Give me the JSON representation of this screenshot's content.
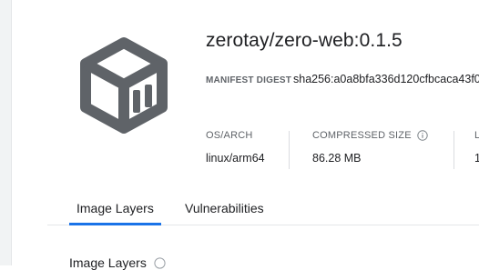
{
  "header": {
    "title": "zerotay/zero-web:0.1.5",
    "manifest_digest_label": "MANIFEST DIGEST",
    "manifest_digest_value": "sha256:a0a8bfa336d120cfbcaca43f0"
  },
  "metadata": {
    "os_arch_label": "OS/ARCH",
    "os_arch_value": "linux/arm64",
    "compressed_size_label": "COMPRESSED SIZE",
    "compressed_size_value": "86.28 MB",
    "third_label": "L",
    "third_value": "1"
  },
  "tabs": [
    {
      "label": "Image Layers",
      "active": true
    },
    {
      "label": "Vulnerabilities",
      "active": false
    }
  ],
  "section": {
    "title": "Image Layers"
  },
  "icons": {
    "image": "container-cube-icon",
    "info": "info-circle-icon",
    "help": "help-circle-icon"
  },
  "colors": {
    "accent": "#1a73e8",
    "icon_gray": "#5f6368",
    "text": "#202124",
    "muted": "#5f6368"
  }
}
